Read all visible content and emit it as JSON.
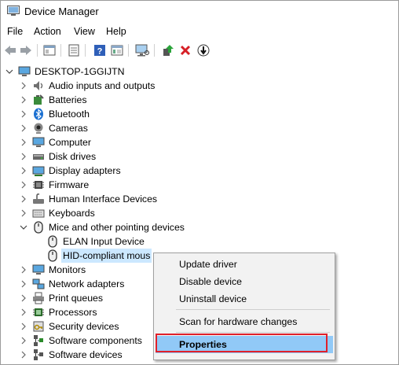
{
  "window": {
    "title": "Device Manager"
  },
  "menu": [
    "File",
    "Action",
    "View",
    "Help"
  ],
  "toolbar": {
    "icons": [
      "back-icon",
      "forward-icon",
      "properties-pane-icon",
      "show-hidden-icon",
      "help-icon",
      "view-icon",
      "monitor-scan-icon",
      "update-driver-icon",
      "uninstall-icon",
      "disable-icon"
    ]
  },
  "tree": {
    "root": "DESKTOP-1GGIJTN",
    "categories": [
      {
        "label": "Audio inputs and outputs",
        "icon": "speaker-icon"
      },
      {
        "label": "Batteries",
        "icon": "battery-icon"
      },
      {
        "label": "Bluetooth",
        "icon": "bluetooth-icon"
      },
      {
        "label": "Cameras",
        "icon": "camera-icon"
      },
      {
        "label": "Computer",
        "icon": "computer-icon"
      },
      {
        "label": "Disk drives",
        "icon": "disk-icon"
      },
      {
        "label": "Display adapters",
        "icon": "display-adapter-icon"
      },
      {
        "label": "Firmware",
        "icon": "firmware-icon"
      },
      {
        "label": "Human Interface Devices",
        "icon": "hid-icon"
      },
      {
        "label": "Keyboards",
        "icon": "keyboard-icon"
      },
      {
        "label": "Mice and other pointing devices",
        "icon": "mouse-icon",
        "expanded": true,
        "children": [
          {
            "label": "ELAN Input Device",
            "icon": "mouse-icon"
          },
          {
            "label": "HID-compliant mous",
            "icon": "mouse-icon",
            "selected": true
          }
        ]
      },
      {
        "label": "Monitors",
        "icon": "monitor-icon"
      },
      {
        "label": "Network adapters",
        "icon": "network-icon"
      },
      {
        "label": "Print queues",
        "icon": "printer-icon"
      },
      {
        "label": "Processors",
        "icon": "processor-icon"
      },
      {
        "label": "Security devices",
        "icon": "security-icon"
      },
      {
        "label": "Software components",
        "icon": "software-component-icon"
      },
      {
        "label": "Software devices",
        "icon": "software-device-icon"
      }
    ]
  },
  "context_menu": {
    "items": [
      "Update driver",
      "Disable device",
      "Uninstall device",
      "Scan for hardware changes",
      "Properties"
    ],
    "highlighted": "Properties"
  },
  "colors": {
    "selection": "#cce8ff",
    "menu_highlight": "#91c9f7",
    "annotation_box": "#e0202a"
  }
}
